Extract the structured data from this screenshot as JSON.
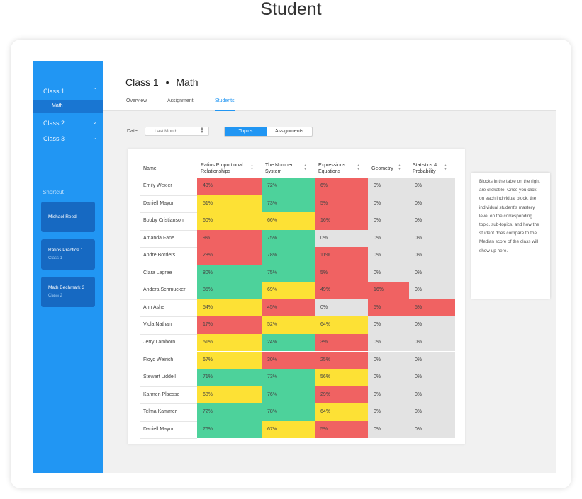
{
  "page_title": "Student",
  "colors": {
    "accent": "#2196f3",
    "red": "#f06262",
    "green": "#4dd29b",
    "yellow": "#fde135",
    "gray": "#e3e3e3"
  },
  "sidebar": {
    "classes": [
      {
        "label": "Class 1",
        "icon": "chevron-up-icon",
        "glyph": "⌃"
      },
      {
        "label": "Class 2",
        "icon": "chevron-down-icon",
        "glyph": "⌄"
      },
      {
        "label": "Class 3",
        "icon": "chevron-down-icon",
        "glyph": "⌄"
      }
    ],
    "active_subitem": "Math",
    "shortcut_label": "Shortcut",
    "shortcuts": [
      {
        "title": "Michael  Reed",
        "subtitle": ""
      },
      {
        "title": "Ratios Practice 1",
        "subtitle": "Class 1"
      },
      {
        "title": "Math Bechmark 3",
        "subtitle": "Class 2"
      }
    ]
  },
  "header": {
    "class_name": "Class 1",
    "separator": "•",
    "subject": "Math",
    "tabs": [
      "Overview",
      "Assignment",
      "Students"
    ],
    "active_tab": "Students"
  },
  "filters": {
    "date_label": "Date",
    "date_value": "Last Month",
    "toggle": [
      "Topics",
      "Assignments"
    ],
    "toggle_active": "Topics"
  },
  "table": {
    "name_header": "Name",
    "columns": [
      {
        "label": [
          "Ratios Proportional",
          "Relationships"
        ]
      },
      {
        "label": [
          "The Number",
          "System"
        ]
      },
      {
        "label": [
          "Expressions",
          "Equations"
        ]
      },
      {
        "label": [
          "Geometry"
        ]
      },
      {
        "label": [
          "Statistics &",
          "Probability"
        ]
      }
    ],
    "rows": [
      {
        "name": "Emily Wexler",
        "values": [
          "43%",
          "72%",
          "6%",
          "0%",
          "0%"
        ],
        "levels": [
          "r",
          "g",
          "r",
          "n",
          "n"
        ]
      },
      {
        "name": "Daniell Mayor",
        "values": [
          "51%",
          "73%",
          "5%",
          "0%",
          "0%"
        ],
        "levels": [
          "y",
          "g",
          "r",
          "n",
          "n"
        ]
      },
      {
        "name": "Bobby Cristianson",
        "values": [
          "60%",
          "66%",
          "16%",
          "0%",
          "0%"
        ],
        "levels": [
          "y",
          "y",
          "r",
          "n",
          "n"
        ]
      },
      {
        "name": "Amanda Fane",
        "values": [
          "9%",
          "75%",
          "0%",
          "0%",
          "0%"
        ],
        "levels": [
          "r",
          "g",
          "n",
          "n",
          "n"
        ]
      },
      {
        "name": "Andre Borders",
        "values": [
          "28%",
          "78%",
          "11%",
          "0%",
          "0%"
        ],
        "levels": [
          "r",
          "g",
          "r",
          "n",
          "n"
        ]
      },
      {
        "name": "Clara Legree",
        "values": [
          "80%",
          "75%",
          "5%",
          "0%",
          "0%"
        ],
        "levels": [
          "g",
          "g",
          "r",
          "n",
          "n"
        ]
      },
      {
        "name": "Andera Schmucker",
        "values": [
          "85%",
          "69%",
          "49%",
          "16%",
          "0%"
        ],
        "levels": [
          "g",
          "y",
          "r",
          "r",
          "n"
        ]
      },
      {
        "name": "Ann Ashe",
        "values": [
          "54%",
          "45%",
          "0%",
          "5%",
          "5%"
        ],
        "levels": [
          "y",
          "r",
          "n",
          "r",
          "r"
        ]
      },
      {
        "name": "Viola Nathan",
        "values": [
          "17%",
          "52%",
          "64%",
          "0%",
          "0%"
        ],
        "levels": [
          "r",
          "y",
          "y",
          "n",
          "n"
        ]
      },
      {
        "name": "Jerry Lamborn",
        "values": [
          "51%",
          "24%",
          "3%",
          "0%",
          "0%"
        ],
        "levels": [
          "y",
          "g",
          "r",
          "n",
          "n"
        ]
      },
      {
        "name": "Floyd Weirich",
        "values": [
          "67%",
          "30%",
          "25%",
          "0%",
          "0%"
        ],
        "levels": [
          "y",
          "r",
          "r",
          "n",
          "n"
        ]
      },
      {
        "name": "Stewart Liddell",
        "values": [
          "71%",
          "73%",
          "56%",
          "0%",
          "0%"
        ],
        "levels": [
          "g",
          "g",
          "y",
          "n",
          "n"
        ]
      },
      {
        "name": "Karmen Plaesse",
        "values": [
          "68%",
          "76%",
          "29%",
          "0%",
          "0%"
        ],
        "levels": [
          "y",
          "g",
          "r",
          "n",
          "n"
        ]
      },
      {
        "name": "Telma Kammer",
        "values": [
          "72%",
          "78%",
          "64%",
          "0%",
          "0%"
        ],
        "levels": [
          "g",
          "g",
          "y",
          "n",
          "n"
        ]
      },
      {
        "name": "Daniell Mayor",
        "values": [
          "76%",
          "67%",
          "5%",
          "0%",
          "0%"
        ],
        "levels": [
          "g",
          "y",
          "r",
          "n",
          "n"
        ]
      }
    ]
  },
  "note": "Blocks in the table on the right are clickable. Once you click on each individual block, the individual student's mastery level on the corresponding topic, sub-topics, and how the student does compare to the Median score of the class will show up here."
}
